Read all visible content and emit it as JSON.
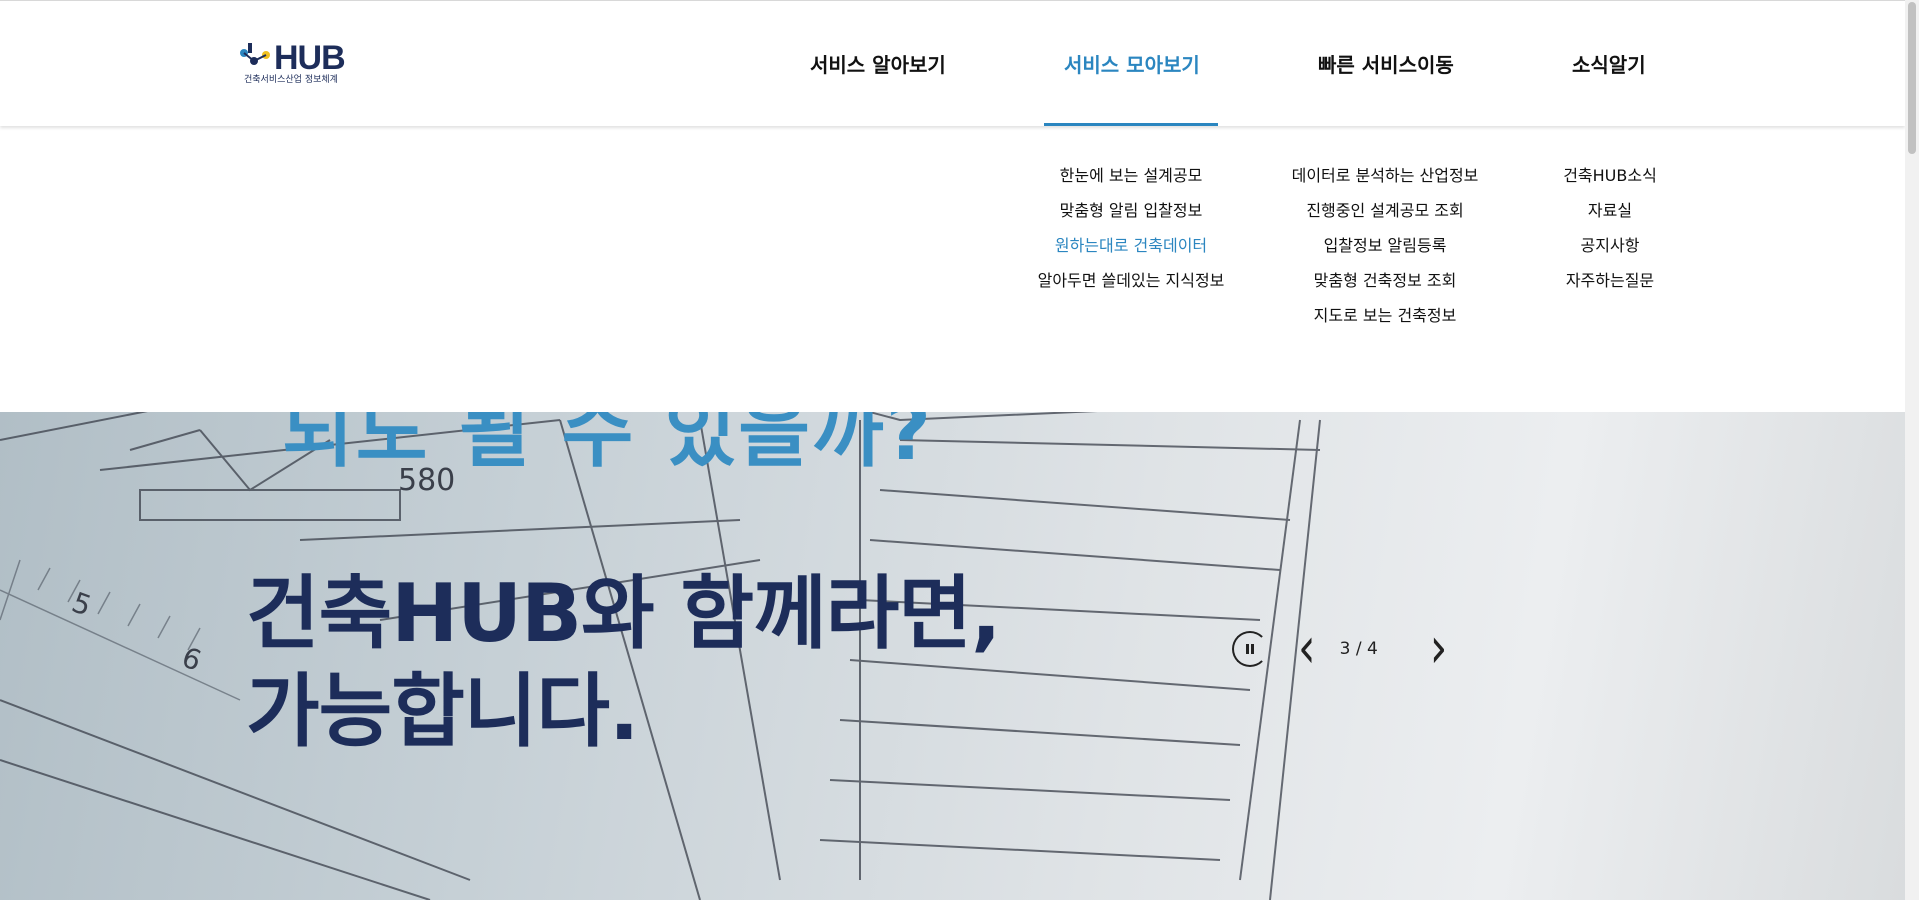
{
  "logo": {
    "text": "HUB",
    "subtitle": "건축서비스산업 정보체계"
  },
  "nav": {
    "items": [
      {
        "label": "서비스 알아보기",
        "active": false
      },
      {
        "label": "서비스 모아보기",
        "active": true
      },
      {
        "label": "빠른 서비스이동",
        "active": false
      },
      {
        "label": "소식알기",
        "active": false
      }
    ]
  },
  "menu": {
    "col1": [
      "한눈에 보는 설계공모",
      "맞춤형 알림 입찰정보",
      "원하는대로 건축데이터",
      "알아두면 쓸데있는 지식정보"
    ],
    "col2": [
      "데이터로 분석하는 산업정보",
      "진행중인 설계공모 조회",
      "입찰정보 알림등록",
      "맞춤형 건축정보 조회",
      "지도로 보는 건축정보"
    ],
    "col3": [
      "건축HUB소식",
      "자료실",
      "공지사항",
      "자주하는질문"
    ],
    "highlighted": "원하는대로 건축데이터"
  },
  "hero": {
    "headline_top_fragment": "되도 될 수 있을까?",
    "headline_line1": "건축HUB와 함께라면,",
    "headline_line2": "가능합니다.",
    "blueprint_label": "580"
  },
  "slider": {
    "counter": "3 / 4",
    "pause_icon": "pause-icon",
    "prev_icon": "chevron-left-icon",
    "next_icon": "chevron-right-icon"
  },
  "colors": {
    "accent": "#2b86c0",
    "navy": "#1d2d5a"
  }
}
